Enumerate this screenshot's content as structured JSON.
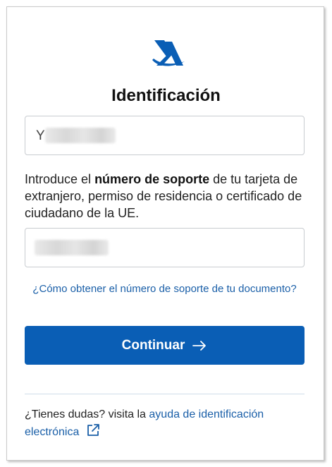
{
  "form": {
    "title": "Identificación",
    "nie_field": {
      "visible_prefix": "Y"
    },
    "instructions": {
      "before": "Introduce el ",
      "bold": "número de soporte",
      "after": " de tu tarjeta de extranjero, permiso de residencia o certificado de ciudadano de la UE."
    },
    "help_link": "¿Cómo obtener el número de soporte de tu documento?",
    "continue_button": "Continuar"
  },
  "footer": {
    "question": "¿Tienes dudas? visita la ",
    "link": "ayuda de identificación electrónica"
  },
  "icons": {
    "logo": "agencia-tributaria-logo",
    "button_arrow": "arrow-right-icon",
    "external": "external-link-icon"
  },
  "colors": {
    "primary": "#0a5eb5",
    "link": "#1a5fa8",
    "logo": "#0a5eb5"
  }
}
